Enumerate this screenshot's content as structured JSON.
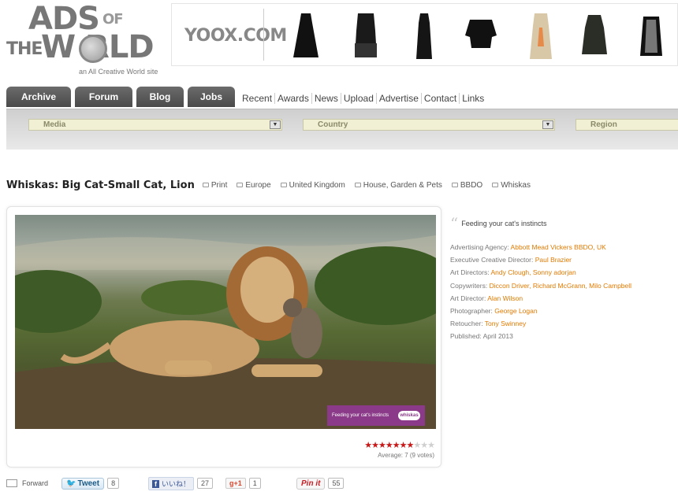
{
  "logo": {
    "ads": "ADS",
    "of": "OF",
    "the": "THE",
    "world": "W  RLD",
    "subtitle": "an All Creative World site"
  },
  "banner": {
    "brand": "YOOX.COM"
  },
  "nav": {
    "tabs": [
      "Archive",
      "Forum",
      "Blog",
      "Jobs"
    ],
    "links": [
      "Recent",
      "Awards",
      "News",
      "Upload",
      "Advertise",
      "Contact",
      "Links"
    ]
  },
  "filters": {
    "media": "Media",
    "country": "Country",
    "region": "Region"
  },
  "ad": {
    "title": "Whiskas: Big Cat-Small Cat, Lion",
    "tags": [
      "Print",
      "Europe",
      "United Kingdom",
      "House, Garden & Pets",
      "BBDO",
      "Whiskas"
    ],
    "badge_text": "Feeding your cat's instincts",
    "badge_brand": "whiskas",
    "rating": 7,
    "rating_max": 10,
    "average_text": "Average: 7 (9 votes)"
  },
  "sidebar": {
    "tagline": "Feeding your cat's instincts",
    "credits": [
      {
        "label": "Advertising Agency:",
        "value": "Abbott Mead Vickers BBDO, UK"
      },
      {
        "label": "Executive Creative Director:",
        "value": "Paul Brazier"
      },
      {
        "label": "Art Directors:",
        "value": "Andy Clough, Sonny adorjan"
      },
      {
        "label": "Copywriters:",
        "value": "Diccon Driver, Richard McGrann, Milo Campbell"
      },
      {
        "label": "Art Director:",
        "value": "Alan Wilson"
      },
      {
        "label": "Photographer:",
        "value": "George Logan"
      },
      {
        "label": "Retoucher:",
        "value": "Tony Swinney"
      },
      {
        "label": "Published:",
        "plain": "April 2013"
      }
    ]
  },
  "social": {
    "forward": "Forward",
    "tweet": "Tweet",
    "tweet_count": "8",
    "fb_label": "いいね！",
    "fb_count": "27",
    "gplus": "+1",
    "gplus_count": "1",
    "pin": "Pin it",
    "pin_count": "55"
  },
  "colors": {
    "accent_orange": "#e27a00",
    "star_red": "#c81818",
    "tab_gray": "#5a5a5a"
  }
}
